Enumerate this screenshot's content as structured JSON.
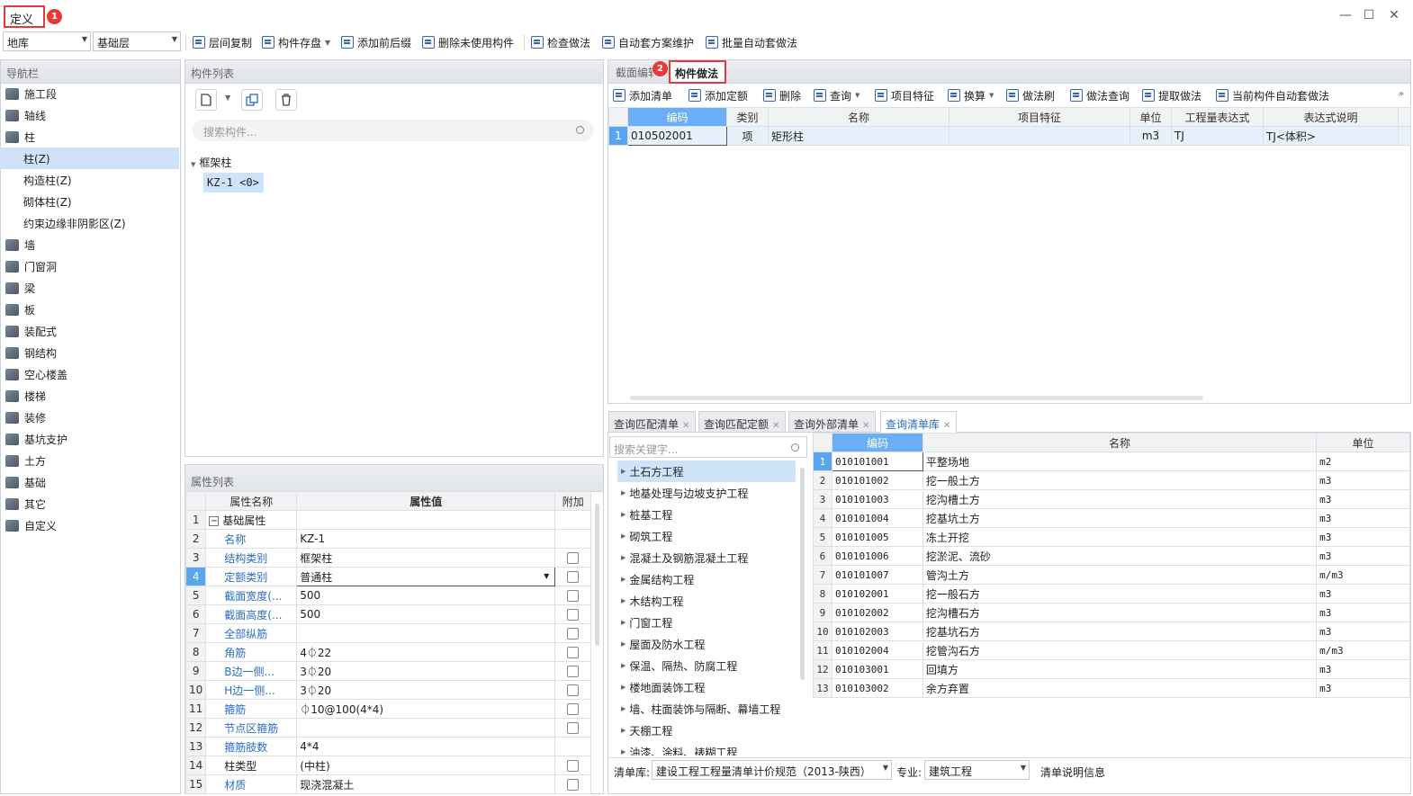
{
  "window": {
    "title": "定义",
    "badge1": "1",
    "min": "—",
    "max": "☐",
    "close": "✕"
  },
  "toolbar": {
    "floor_combo": "地库",
    "layer_combo": "基础层",
    "items": [
      "层间复制",
      "构件存盘",
      "添加前后缀",
      "删除未使用构件",
      "检查做法",
      "自动套方案维护",
      "批量自动套做法"
    ]
  },
  "nav": {
    "title": "导航栏",
    "items": [
      {
        "label": "施工段",
        "sub": false
      },
      {
        "label": "轴线",
        "sub": false
      },
      {
        "label": "柱",
        "sub": false
      },
      {
        "label": "柱(Z)",
        "sub": true,
        "sel": true
      },
      {
        "label": "构造柱(Z)",
        "sub": true
      },
      {
        "label": "砌体柱(Z)",
        "sub": true
      },
      {
        "label": "约束边缘非阴影区(Z)",
        "sub": true
      },
      {
        "label": "墙",
        "sub": false
      },
      {
        "label": "门窗洞",
        "sub": false
      },
      {
        "label": "梁",
        "sub": false
      },
      {
        "label": "板",
        "sub": false
      },
      {
        "label": "装配式",
        "sub": false
      },
      {
        "label": "钢结构",
        "sub": false
      },
      {
        "label": "空心楼盖",
        "sub": false
      },
      {
        "label": "楼梯",
        "sub": false
      },
      {
        "label": "装修",
        "sub": false
      },
      {
        "label": "基坑支护",
        "sub": false
      },
      {
        "label": "土方",
        "sub": false
      },
      {
        "label": "基础",
        "sub": false
      },
      {
        "label": "其它",
        "sub": false
      },
      {
        "label": "自定义",
        "sub": false
      }
    ]
  },
  "component_list": {
    "title": "构件列表",
    "search_placeholder": "搜索构件...",
    "group": "框架柱",
    "item": "KZ-1 <0>"
  },
  "props": {
    "title": "属性列表",
    "headers": [
      "属性名称",
      "属性值",
      "附加"
    ],
    "rows": [
      {
        "n": "1",
        "name": "基础属性",
        "val": "",
        "chk": false,
        "group": true
      },
      {
        "n": "2",
        "name": "名称",
        "val": "KZ-1",
        "chk": false
      },
      {
        "n": "3",
        "name": "结构类别",
        "val": "框架柱",
        "chk": true
      },
      {
        "n": "4",
        "name": "定额类别",
        "val": "普通柱",
        "chk": true,
        "active": true
      },
      {
        "n": "5",
        "name": "截面宽度(...",
        "val": "500",
        "chk": true
      },
      {
        "n": "6",
        "name": "截面高度(...",
        "val": "500",
        "chk": true
      },
      {
        "n": "7",
        "name": "全部纵筋",
        "val": "",
        "chk": true
      },
      {
        "n": "8",
        "name": "角筋",
        "val": "4⏀22",
        "chk": true
      },
      {
        "n": "9",
        "name": "B边一侧...",
        "val": "3⏀20",
        "chk": true
      },
      {
        "n": "10",
        "name": "H边一侧...",
        "val": "3⏀20",
        "chk": true
      },
      {
        "n": "11",
        "name": "箍筋",
        "val": "⏀10@100(4*4)",
        "chk": true
      },
      {
        "n": "12",
        "name": "节点区箍筋",
        "val": "",
        "chk": true
      },
      {
        "n": "13",
        "name": "箍筋肢数",
        "val": "4*4",
        "chk": false
      },
      {
        "n": "14",
        "name": "柱类型",
        "val": "(中柱)",
        "chk": true,
        "black": true
      },
      {
        "n": "15",
        "name": "材质",
        "val": "现浇混凝土",
        "chk": true
      }
    ]
  },
  "method": {
    "tab1": "截面编辑",
    "tab2": "构件做法",
    "badge2": "2",
    "tools": [
      "添加清单",
      "添加定额",
      "删除",
      "查询",
      "项目特征",
      "换算",
      "做法刷",
      "做法查询",
      "提取做法",
      "当前构件自动套做法"
    ],
    "headers": [
      "编码",
      "类别",
      "名称",
      "项目特征",
      "单位",
      "工程量表达式",
      "表达式说明"
    ],
    "rows": [
      {
        "n": "1",
        "code": "010502001",
        "cat": "项",
        "name": "矩形柱",
        "feat": "",
        "unit": "m3",
        "expr": "TJ",
        "desc": "TJ<体积>"
      }
    ]
  },
  "query": {
    "tabs": [
      "查询匹配清单",
      "查询匹配定额",
      "查询外部清单",
      "查询清单库"
    ],
    "search_placeholder": "搜索关键字...",
    "tree": [
      "土石方工程",
      "地基处理与边坡支护工程",
      "桩基工程",
      "砌筑工程",
      "混凝土及钢筋混凝土工程",
      "金属结构工程",
      "木结构工程",
      "门窗工程",
      "屋面及防水工程",
      "保温、隔热、防腐工程",
      "楼地面装饰工程",
      "墙、柱面装饰与隔断、幕墙工程",
      "天棚工程",
      "油漆、涂料、裱糊工程"
    ],
    "headers": [
      "编码",
      "名称",
      "单位"
    ],
    "rows": [
      {
        "n": "1",
        "code": "010101001",
        "name": "平整场地",
        "unit": "m2"
      },
      {
        "n": "2",
        "code": "010101002",
        "name": "挖一般土方",
        "unit": "m3"
      },
      {
        "n": "3",
        "code": "010101003",
        "name": "挖沟槽土方",
        "unit": "m3"
      },
      {
        "n": "4",
        "code": "010101004",
        "name": "挖基坑土方",
        "unit": "m3"
      },
      {
        "n": "5",
        "code": "010101005",
        "name": "冻土开挖",
        "unit": "m3"
      },
      {
        "n": "6",
        "code": "010101006",
        "name": "挖淤泥、流砂",
        "unit": "m3"
      },
      {
        "n": "7",
        "code": "010101007",
        "name": "管沟土方",
        "unit": "m/m3"
      },
      {
        "n": "8",
        "code": "010102001",
        "name": "挖一般石方",
        "unit": "m3"
      },
      {
        "n": "9",
        "code": "010102002",
        "name": "挖沟槽石方",
        "unit": "m3"
      },
      {
        "n": "10",
        "code": "010102003",
        "name": "挖基坑石方",
        "unit": "m3"
      },
      {
        "n": "11",
        "code": "010102004",
        "name": "挖管沟石方",
        "unit": "m/m3"
      },
      {
        "n": "12",
        "code": "010103001",
        "name": "回填方",
        "unit": "m3"
      },
      {
        "n": "13",
        "code": "010103002",
        "name": "余方弃置",
        "unit": "m3"
      }
    ],
    "footer": {
      "lib_label": "清单库:",
      "lib_value": "建设工程工程量清单计价规范（2013-陕西）",
      "spec_label": "专业:",
      "spec_value": "建筑工程",
      "info": "清单说明信息"
    }
  }
}
